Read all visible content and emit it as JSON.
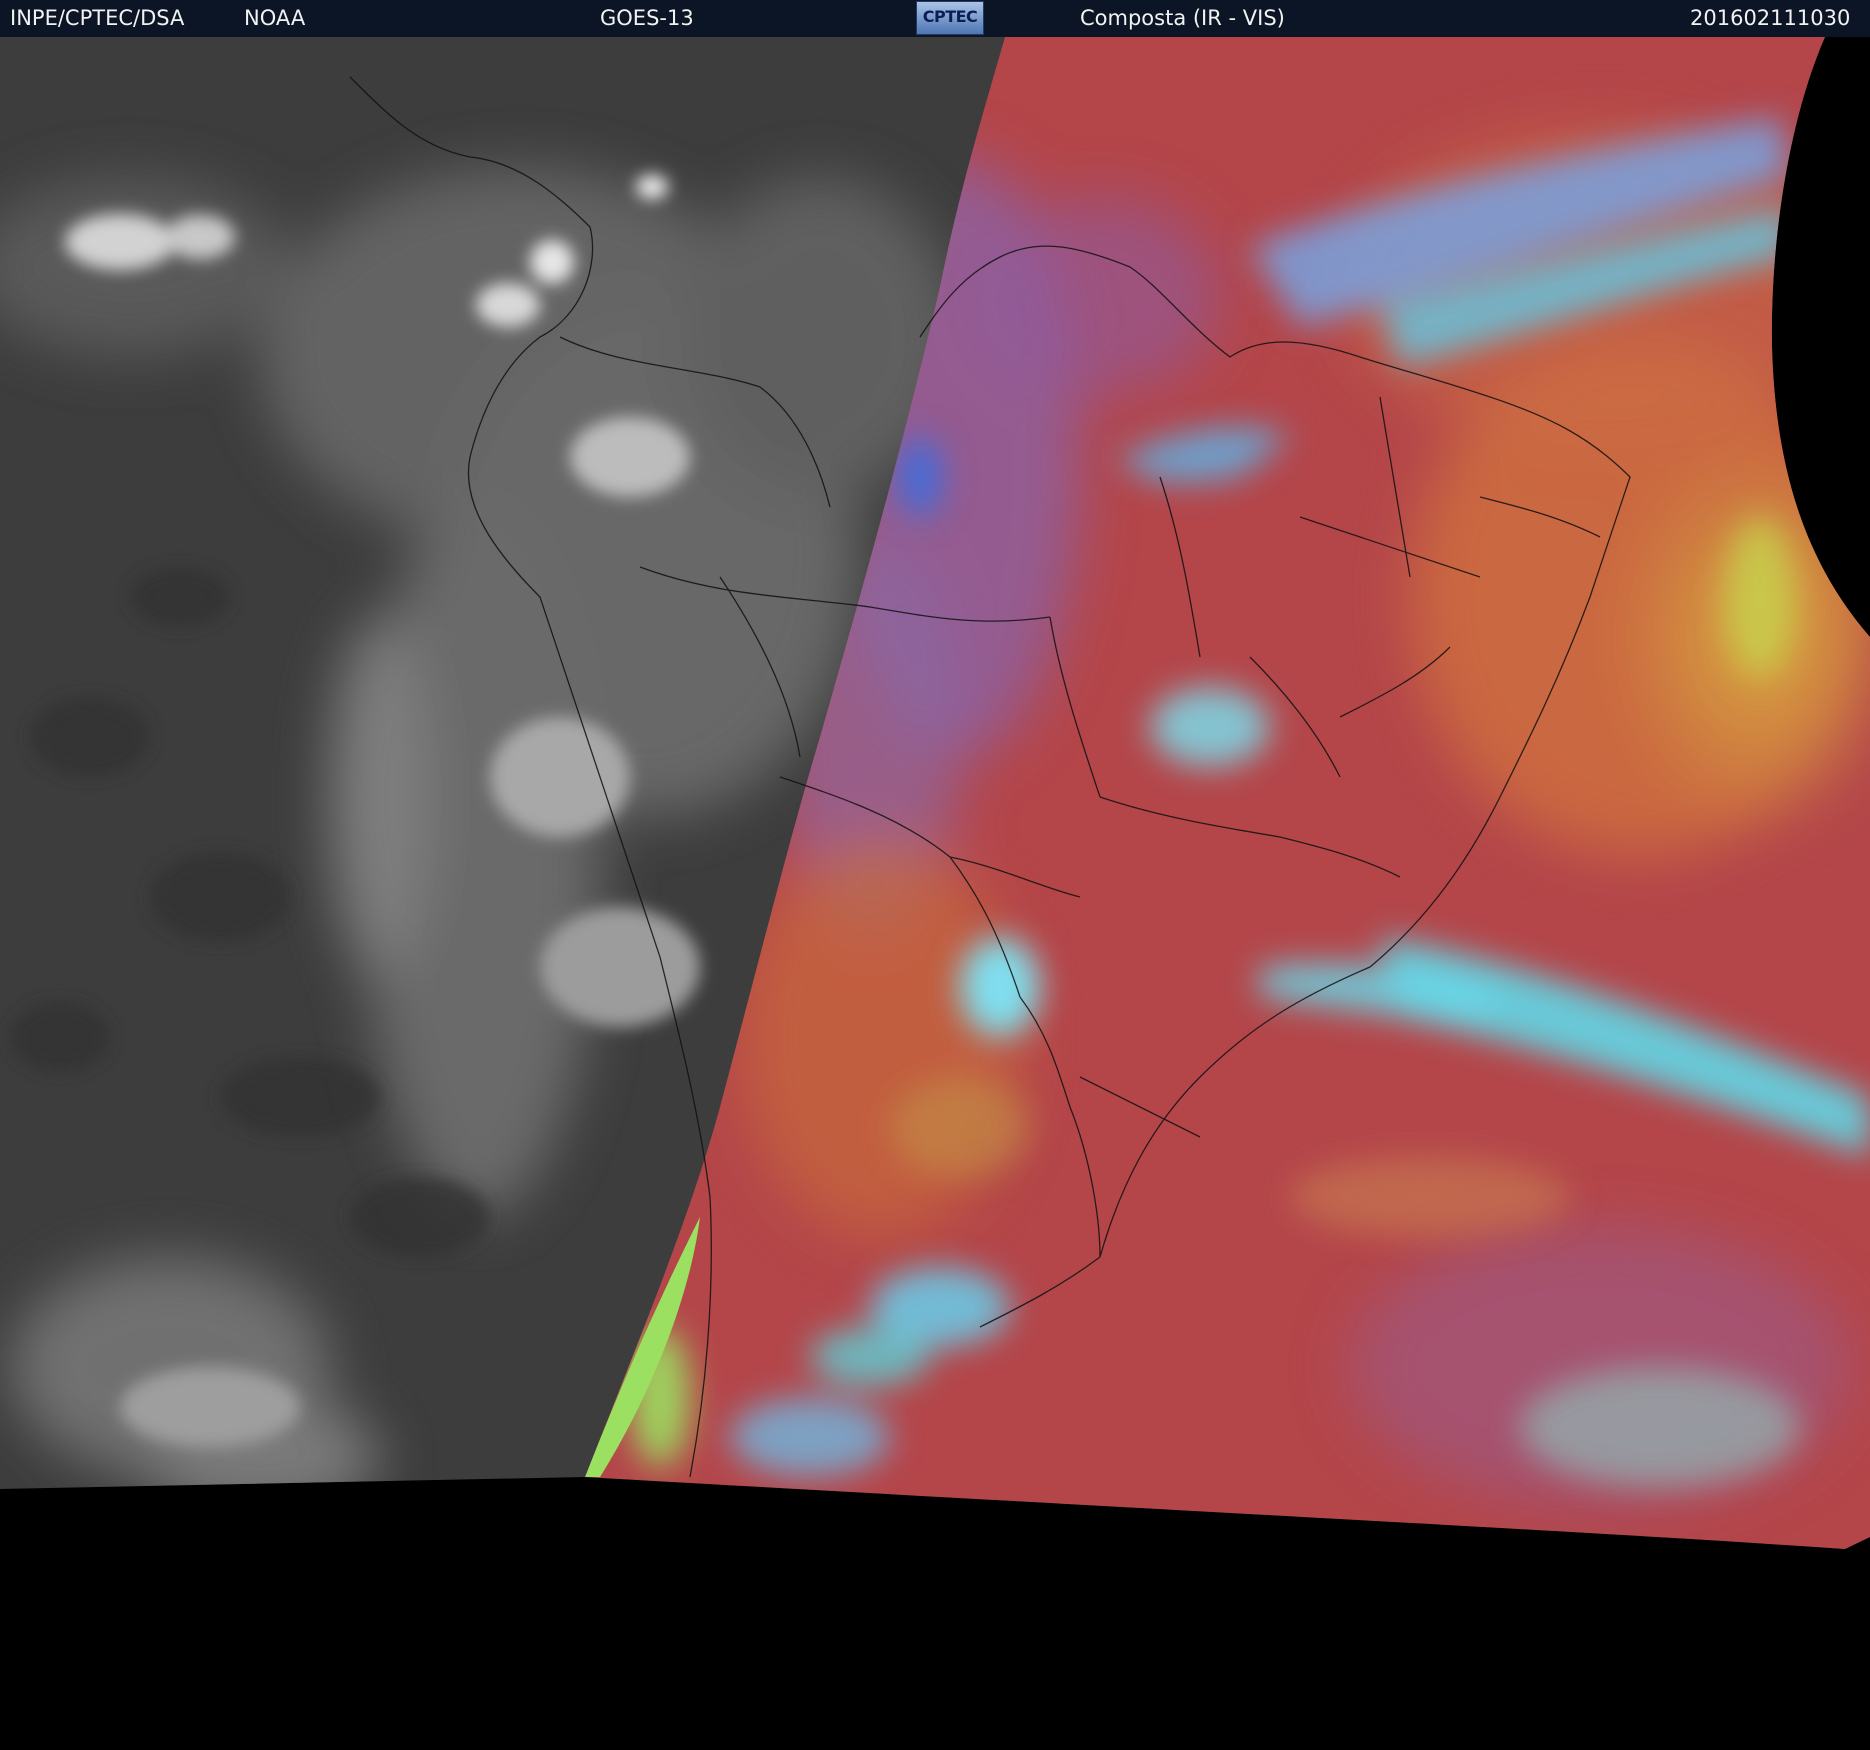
{
  "header": {
    "org": "INPE/CPTEC/DSA",
    "agency": "NOAA",
    "satellite": "GOES-13",
    "logo_text": "CPTEC",
    "product": "Composta (IR - VIS)",
    "timestamp": "201602111030"
  },
  "colors": {
    "header_bg": "#0b1526",
    "ir_gray": "#3b3b3b",
    "composite_red": "#b4464a",
    "cloud_cyan": "#5fd8e8",
    "cloud_green": "#9be060",
    "space": "#000000"
  }
}
